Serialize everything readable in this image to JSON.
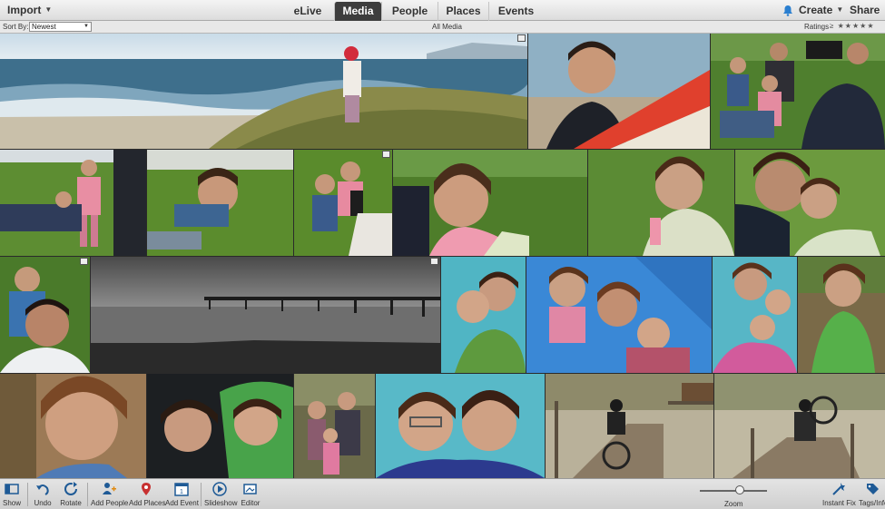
{
  "topbar": {
    "import_label": "Import",
    "tabs": [
      {
        "label": "eLive",
        "active": false
      },
      {
        "label": "Media",
        "active": true
      },
      {
        "label": "People",
        "active": false
      },
      {
        "label": "Places",
        "active": false
      },
      {
        "label": "Events",
        "active": false
      }
    ],
    "create_label": "Create",
    "share_label": "Share",
    "icons": {
      "notification": "bell-icon",
      "dropdown": "caret-down-icon"
    }
  },
  "sortbar": {
    "sort_label": "Sort By:",
    "sort_value": "Newest",
    "view_title": "All Media",
    "ratings_label": "Ratings",
    "ratings_comparator": "≥",
    "stars": "★★★★★"
  },
  "bottombar": {
    "tools": [
      {
        "label": "Show",
        "icon": "panel-toggle-icon"
      },
      {
        "label": "Undo",
        "icon": "undo-icon"
      },
      {
        "label": "Rotate",
        "icon": "rotate-icon"
      },
      {
        "label": "Add People",
        "icon": "add-people-icon"
      },
      {
        "label": "Add Places",
        "icon": "map-pin-icon"
      },
      {
        "label": "Add Event",
        "icon": "calendar-icon"
      },
      {
        "label": "Slideshow",
        "icon": "play-icon"
      },
      {
        "label": "Editor",
        "icon": "editor-icon"
      }
    ],
    "zoom_label": "Zoom",
    "zoom_level": 0.6,
    "right_tools": [
      {
        "label": "Instant Fix",
        "icon": "instant-fix-icon"
      },
      {
        "label": "Tags/Info",
        "icon": "tag-icon"
      }
    ]
  },
  "colors": {
    "active_tab": "#3d3d3d",
    "chrome_light": "#e8e8e8",
    "accent_blue": "#2a7fd0"
  }
}
